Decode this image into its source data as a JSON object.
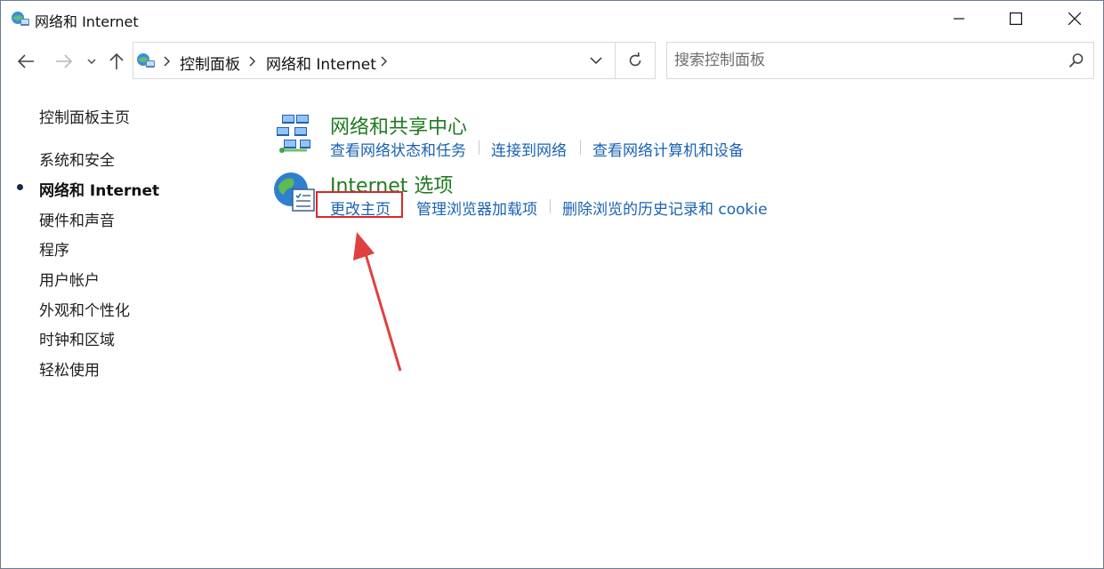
{
  "window": {
    "title": "网络和 Internet",
    "controls": {
      "minimize_icon": "minimize-icon",
      "maximize_icon": "maximize-icon",
      "close_icon": "close-icon"
    }
  },
  "toolbar": {
    "back_icon": "back-arrow-icon",
    "forward_icon": "forward-arrow-icon",
    "recent_icon": "chevron-down-icon",
    "up_icon": "up-arrow-icon"
  },
  "address": {
    "breadcrumbs": [
      "控制面板",
      "网络和 Internet"
    ],
    "dropdown_icon": "chevron-down-icon",
    "refresh_icon": "refresh-icon"
  },
  "search": {
    "placeholder": "搜索控制面板",
    "value": "",
    "icon": "search-icon"
  },
  "sidebar": {
    "home": "控制面板主页",
    "items": [
      {
        "label": "系统和安全",
        "active": false
      },
      {
        "label": "网络和 Internet",
        "active": true
      },
      {
        "label": "硬件和声音",
        "active": false
      },
      {
        "label": "程序",
        "active": false
      },
      {
        "label": "用户帐户",
        "active": false
      },
      {
        "label": "外观和个性化",
        "active": false
      },
      {
        "label": "时钟和区域",
        "active": false
      },
      {
        "label": "轻松使用",
        "active": false
      }
    ]
  },
  "main": {
    "categories": [
      {
        "title": "网络和共享中心",
        "icon": "network-sharing-center-icon",
        "links": [
          "查看网络状态和任务",
          "连接到网络",
          "查看网络计算机和设备"
        ]
      },
      {
        "title": "Internet 选项",
        "icon": "internet-options-globe-icon",
        "links": [
          "更改主页",
          "管理浏览器加载项",
          "删除浏览的历史记录和 cookie"
        ]
      }
    ]
  },
  "annotation": {
    "highlight_color": "#d9272e",
    "highlighted_link": "更改主页"
  },
  "colors": {
    "category_title": "#1f7a1f",
    "link": "#1a62b3",
    "border": "#d9d9d9"
  }
}
